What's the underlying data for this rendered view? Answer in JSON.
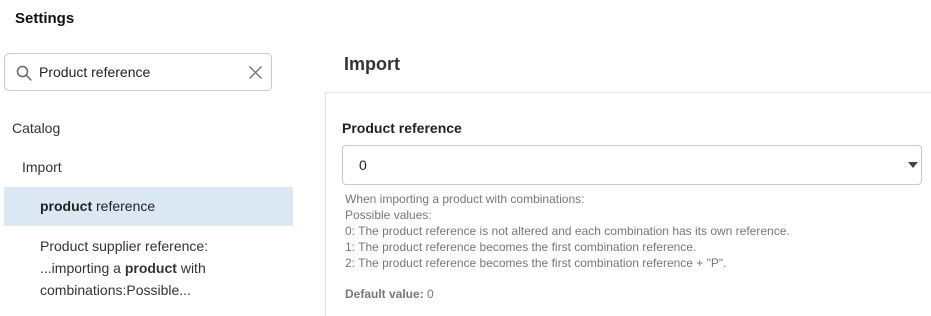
{
  "app": {
    "title": "Settings"
  },
  "search": {
    "value": "Product reference",
    "icon": "search-icon",
    "clear_icon": "close-icon"
  },
  "sidebar": {
    "section": "Catalog",
    "subsection": "Import",
    "results": [
      {
        "bold": "product",
        "rest": " reference",
        "active": true
      },
      {
        "line1": "Product supplier reference:",
        "line2_pre": "...importing a ",
        "line2_bold": "product",
        "line2_post": " with",
        "line3": "combinations:Possible..."
      }
    ]
  },
  "content": {
    "title": "Import",
    "field": {
      "label": "Product reference",
      "value": "0",
      "help": [
        "When importing a product with combinations:",
        "Possible values:",
        "0: The product reference is not altered and each combination has its own reference.",
        "1: The product reference becomes the first combination reference.",
        "2: The product reference becomes the first combination reference + \"P\"."
      ],
      "default_label": "Default value:",
      "default_value": "0"
    }
  },
  "colors": {
    "active_bg": "#dbe8f3",
    "border": "#c9c9c9",
    "help_text": "#777777"
  }
}
